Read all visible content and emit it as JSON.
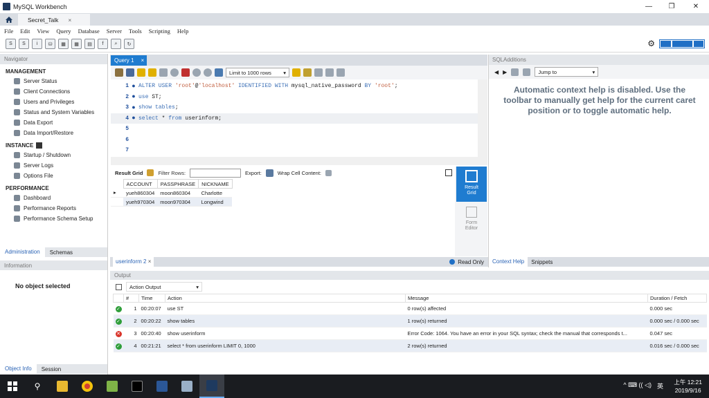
{
  "window": {
    "title": "MySQL Workbench",
    "minimize": "—",
    "maximize": "❐",
    "close": "✕"
  },
  "connection_tab": {
    "label": "Secret_Talk",
    "close": "×"
  },
  "menu": [
    "File",
    "Edit",
    "View",
    "Query",
    "Database",
    "Server",
    "Tools",
    "Scripting",
    "Help"
  ],
  "navigator": {
    "header": "Navigator",
    "management": {
      "title": "MANAGEMENT",
      "items": [
        "Server Status",
        "Client Connections",
        "Users and Privileges",
        "Status and System Variables",
        "Data Export",
        "Data Import/Restore"
      ]
    },
    "instance": {
      "title": "INSTANCE",
      "items": [
        "Startup / Shutdown",
        "Server Logs",
        "Options File"
      ]
    },
    "performance": {
      "title": "PERFORMANCE",
      "items": [
        "Dashboard",
        "Performance Reports",
        "Performance Schema Setup"
      ]
    },
    "tabs": [
      "Administration",
      "Schemas"
    ]
  },
  "information": {
    "header": "Information",
    "empty": "No object selected",
    "tabs": [
      "Object Info",
      "Session"
    ]
  },
  "query": {
    "tab_label": "Query 1",
    "tab_close": "×",
    "limit": "Limit to 1000 rows",
    "lines": [
      {
        "n": "1",
        "parts": [
          [
            "kw",
            "ALTER USER "
          ],
          [
            "str",
            "'root'"
          ],
          [
            "",
            "@"
          ],
          [
            "str",
            "'localhost'"
          ],
          [
            "kw",
            " IDENTIFIED WITH "
          ],
          [
            "",
            "mysql_native_password "
          ],
          [
            "kw",
            "BY "
          ],
          [
            "str",
            "'root'"
          ],
          [
            "",
            ";"
          ]
        ]
      },
      {
        "n": "2",
        "parts": [
          [
            "kw",
            "use "
          ],
          [
            "",
            "ST;"
          ]
        ]
      },
      {
        "n": "3",
        "parts": [
          [
            "kw",
            "show tables"
          ],
          [
            "",
            ";"
          ]
        ]
      },
      {
        "n": "4",
        "parts": [
          [
            "kw",
            "select "
          ],
          [
            "",
            "* "
          ],
          [
            "kw",
            "from "
          ],
          [
            "",
            "userinform;"
          ]
        ]
      },
      {
        "n": "5",
        "parts": []
      },
      {
        "n": "6",
        "parts": []
      },
      {
        "n": "7",
        "parts": []
      }
    ]
  },
  "result": {
    "result_grid_label": "Result Grid",
    "filter_label": "Filter Rows:",
    "export_label": "Export:",
    "wrap_label": "Wrap Cell Content:",
    "columns": [
      "ACCOUNT",
      "PASSPHRASE",
      "NICKNAME"
    ],
    "rows": [
      [
        "yueh860304",
        "moon860304",
        "Charlotte"
      ],
      [
        "yueh970304",
        "moon970304",
        "Longwind"
      ]
    ],
    "side_result_grid": "Result Grid",
    "side_form_editor": "Form Editor",
    "status_tab": "userinform 2",
    "status_tab_close": "×",
    "read_only": "Read Only"
  },
  "sql_additions": {
    "header": "SQLAdditions",
    "jump_to": "Jump to",
    "help_text": "Automatic context help is disabled. Use the toolbar to manually get help for the current caret position or to toggle automatic help.",
    "tabs": [
      "Context Help",
      "Snippets"
    ]
  },
  "output": {
    "header": "Output",
    "selector": "Action Output",
    "columns": [
      "",
      "#",
      "Time",
      "Action",
      "Message",
      "Duration / Fetch"
    ],
    "rows": [
      {
        "status": "ok",
        "num": "1",
        "time": "00:20:07",
        "action": "use ST",
        "message": "0 row(s) affected",
        "duration": "0.000 sec"
      },
      {
        "status": "ok",
        "num": "2",
        "time": "00:20:22",
        "action": "show tables",
        "message": "1 row(s) returned",
        "duration": "0.000 sec / 0.000 sec"
      },
      {
        "status": "err",
        "num": "3",
        "time": "00:20:40",
        "action": "show userinform",
        "message": "Error Code: 1064. You have an error in your SQL syntax; check the manual that corresponds t...",
        "duration": "0.047 sec"
      },
      {
        "status": "ok",
        "num": "4",
        "time": "00:21:21",
        "action": "select * from userinform LIMIT 0, 1000",
        "message": "2 row(s) returned",
        "duration": "0.016 sec / 0.000 sec"
      }
    ]
  },
  "taskbar": {
    "time": "上午 12:21",
    "date": "2019/9/16",
    "ime": "英",
    "tray": "^ ⌨ ((  ◁)"
  }
}
